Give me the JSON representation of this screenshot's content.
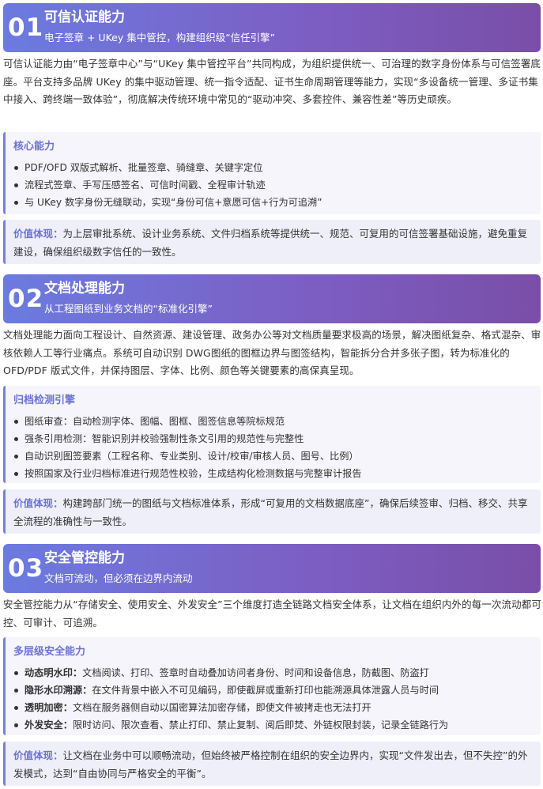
{
  "sections": [
    {
      "number": "01",
      "title": "可信认证能力",
      "subtitle": "电子签章 + UKey 集中管控，构建组织级“信任引擎”",
      "intro": "可信认证能力由“电子签章中心”与“UKey 集中管控平台”共同构成，为组织提供统一、可治理的数字身份体系与可信签署底座。平台支持多品牌 UKey 的集中驱动管理、统一指令适配、证书生命周期管理等能力，实现“多设备统一管理、多证书集中接入、跨终端一致体验”，彻底解决传统环境中常见的“驱动冲突、多套控件、兼容性差”等历史顽疾。",
      "card_title": "核心能力",
      "items": [
        {
          "label": "",
          "text": "PDF/OFD 双版式解析、批量签章、骑缝章、关键字定位"
        },
        {
          "label": "",
          "text": "流程式签章、手写压感签名、可信时间戳、全程审计轨迹"
        },
        {
          "label": "",
          "text": "与 UKey 数字身份无缝联动，实现“身份可信+意愿可信+行为可追溯”"
        }
      ],
      "value_label": "价值体现：",
      "value_text": "为上层审批系统、设计业务系统、文件归档系统等提供统一、规范、可复用的可信签署基础设施，避免重复建设，确保组织级数字信任的一致性。"
    },
    {
      "number": "02",
      "title": "文档处理能力",
      "subtitle": "从工程图纸到业务文档的“标准化引擎”",
      "intro": "文档处理能力面向工程设计、自然资源、建设管理、政务办公等对文档质量要求极高的场景，解决图纸复杂、格式混杂、审核依赖人工等行业痛点。系统可自动识别 DWG图纸的图框边界与图签结构，智能拆分合并多张子图，转为标准化的 OFD/PDF 版式文件，并保持图层、字体、比例、颜色等关键要素的高保真呈现。",
      "card_title": "归档检测引擎",
      "items": [
        {
          "label": "",
          "text": "图纸审查：自动检测字体、图幅、图框、图签信息等院标规范"
        },
        {
          "label": "",
          "text": "强条引用检测：智能识别并校验强制性条文引用的规范性与完整性"
        },
        {
          "label": "",
          "text": "自动识别图签要素（工程名称、专业类别、设计/校审/审核人员、图号、比例）"
        },
        {
          "label": "",
          "text": "按照国家及行业归档标准进行规范性校验，生成结构化检测数据与完整审计报告"
        }
      ],
      "value_label": "价值体现：",
      "value_text": "构建跨部门统一的图纸与文档标准体系，形成“可复用的文档数据底座”，确保后续签审、归档、移交、共享全流程的准确性与一致性。"
    },
    {
      "number": "03",
      "title": "安全管控能力",
      "subtitle": "文档可流动，但必须在边界内流动",
      "intro": "安全管控能力从“存储安全、使用安全、外发安全”三个维度打造全链路文档安全体系，让文档在组织内外的每一次流动都可控、可审计、可追溯。",
      "card_title": "多层级安全能力",
      "items": [
        {
          "label": "动态明水印：",
          "text": "文档阅读、打印、签章时自动叠加访问者身份、时间和设备信息，防截图、防盗打"
        },
        {
          "label": "隐形水印溯源：",
          "text": "在文件背景中嵌入不可见编码，即使截屏或重新打印也能溯源具体泄露人员与时间"
        },
        {
          "label": "透明加密：",
          "text": "文档在服务器侧自动以国密算法加密存储，即使文件被拷走也无法打开"
        },
        {
          "label": "外发安全：",
          "text": "限时访问、限次查看、禁止打印、禁止复制、阅后即焚、外链权限封装，记录全链路行为"
        }
      ],
      "value_label": "价值体现：",
      "value_text": "让文档在业务中可以顺畅流动，但始终被严格控制在组织的安全边界内，实现“文件发出去，但不失控”的外发模式，达到“自由协同与严格安全的平衡”。"
    }
  ]
}
